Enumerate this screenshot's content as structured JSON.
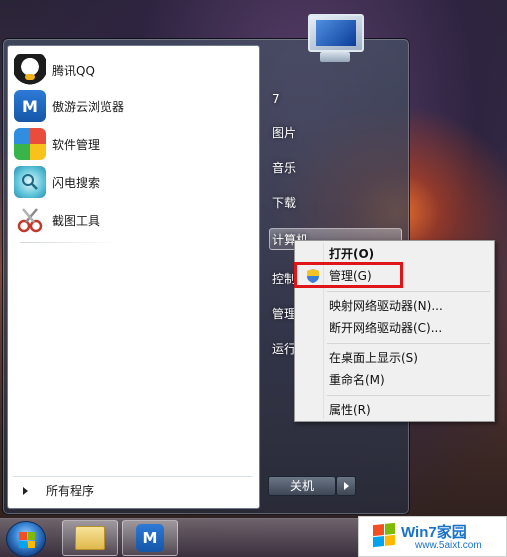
{
  "start_menu": {
    "pinned_programs": [
      {
        "label": "腾讯QQ",
        "icon": "qq-penguin-icon"
      },
      {
        "label": "傲游云浏览器",
        "icon": "maxthon-browser-icon"
      },
      {
        "label": "软件管理",
        "icon": "software-manager-icon"
      },
      {
        "label": "闪电搜索",
        "icon": "flash-search-icon"
      },
      {
        "label": "截图工具",
        "icon": "snipping-tool-icon"
      }
    ],
    "all_programs_label": "所有程序",
    "right_items": [
      {
        "label": "7"
      },
      {
        "label": "图片"
      },
      {
        "label": "音乐"
      },
      {
        "label": "下载"
      },
      {
        "label": "计算机"
      },
      {
        "label": "控制面板"
      },
      {
        "label": "管理工具"
      },
      {
        "label": "运行..."
      }
    ],
    "shutdown_label": "关机",
    "monogram": "M"
  },
  "context_menu": {
    "items": [
      {
        "label": "打开(O)",
        "bold": true
      },
      {
        "label": "管理(G)",
        "icon": "uac-shield-icon"
      },
      {
        "label": "映射网络驱动器(N)..."
      },
      {
        "label": "断开网络驱动器(C)..."
      },
      {
        "label": "在桌面上显示(S)"
      },
      {
        "label": "重命名(M)"
      },
      {
        "label": "属性(R)"
      }
    ],
    "highlight_color": "#e0151a"
  },
  "taskbar": {
    "pinned": [
      "windows-explorer-icon",
      "maxthon-browser-icon"
    ]
  },
  "watermark": {
    "title": "Win7家园",
    "url": "www.5aixt.com"
  }
}
